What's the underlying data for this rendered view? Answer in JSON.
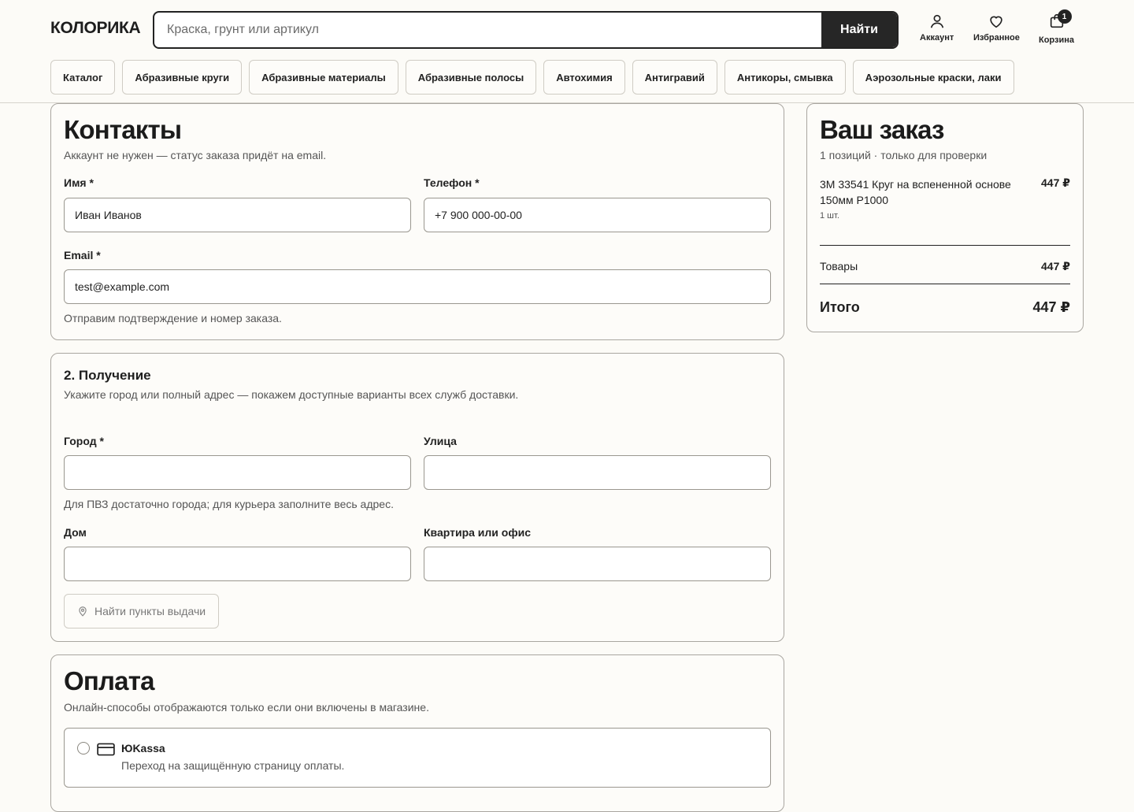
{
  "header": {
    "logo": "КОЛОРИКА",
    "search_placeholder": "Краска, грунт или артикул",
    "search_button": "Найти",
    "account": "Аккаунт",
    "favorites": "Избранное",
    "cart": "Корзина",
    "cart_count": "1"
  },
  "categories": [
    "Каталог",
    "Абразивные круги",
    "Абразивные материалы",
    "Абразивные полосы",
    "Автохимия",
    "Антигравий",
    "Антикоры, смывка",
    "Аэрозольные краски, лаки"
  ],
  "contacts": {
    "title": "Контакты",
    "subtitle": "Аккаунт не нужен — статус заказа придёт на email.",
    "name_label": "Имя *",
    "name_value": "Иван Иванов",
    "phone_label": "Телефон *",
    "phone_value": "+7 900 000-00-00",
    "email_label": "Email *",
    "email_value": "test@example.com",
    "email_hint": "Отправим подтверждение и номер заказа."
  },
  "delivery": {
    "title": "2. Получение",
    "subtitle": "Укажите город или полный адрес — покажем доступные варианты всех служб доставки.",
    "city_label": "Город *",
    "street_label": "Улица",
    "city_hint": "Для ПВЗ достаточно города; для курьера заполните весь адрес.",
    "house_label": "Дом",
    "apartment_label": "Квартира или офис",
    "find_button": "Найти пункты выдачи"
  },
  "payment": {
    "title": "Оплата",
    "subtitle": "Онлайн-способы отображаются только если они включены в магазине.",
    "option_name": "ЮKassa",
    "option_desc": "Переход на защищённую страницу оплаты."
  },
  "order": {
    "title": "Ваш заказ",
    "subtitle": "1 позиций · только для проверки",
    "item_name": "3M 33541 Круг на вспененной основе 150мм P1000",
    "item_price": "447 ₽",
    "item_qty": "1 шт.",
    "goods_label": "Товары",
    "goods_value": "447 ₽",
    "total_label": "Итого",
    "total_value": "447 ₽"
  }
}
